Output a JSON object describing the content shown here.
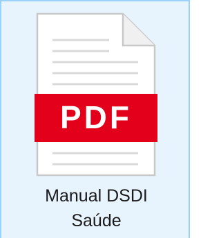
{
  "file": {
    "name": "Manual DSDI\nSaúde",
    "icon": "pdf-file-icon",
    "badge_text": "PDF"
  },
  "colors": {
    "selection_background": "#e8f4fd",
    "selection_border": "#99d1ff",
    "badge_red": "#e2001a",
    "page_fill": "#ffffff",
    "page_outline": "#c8c8c8",
    "page_lines": "#d9d9d9"
  }
}
